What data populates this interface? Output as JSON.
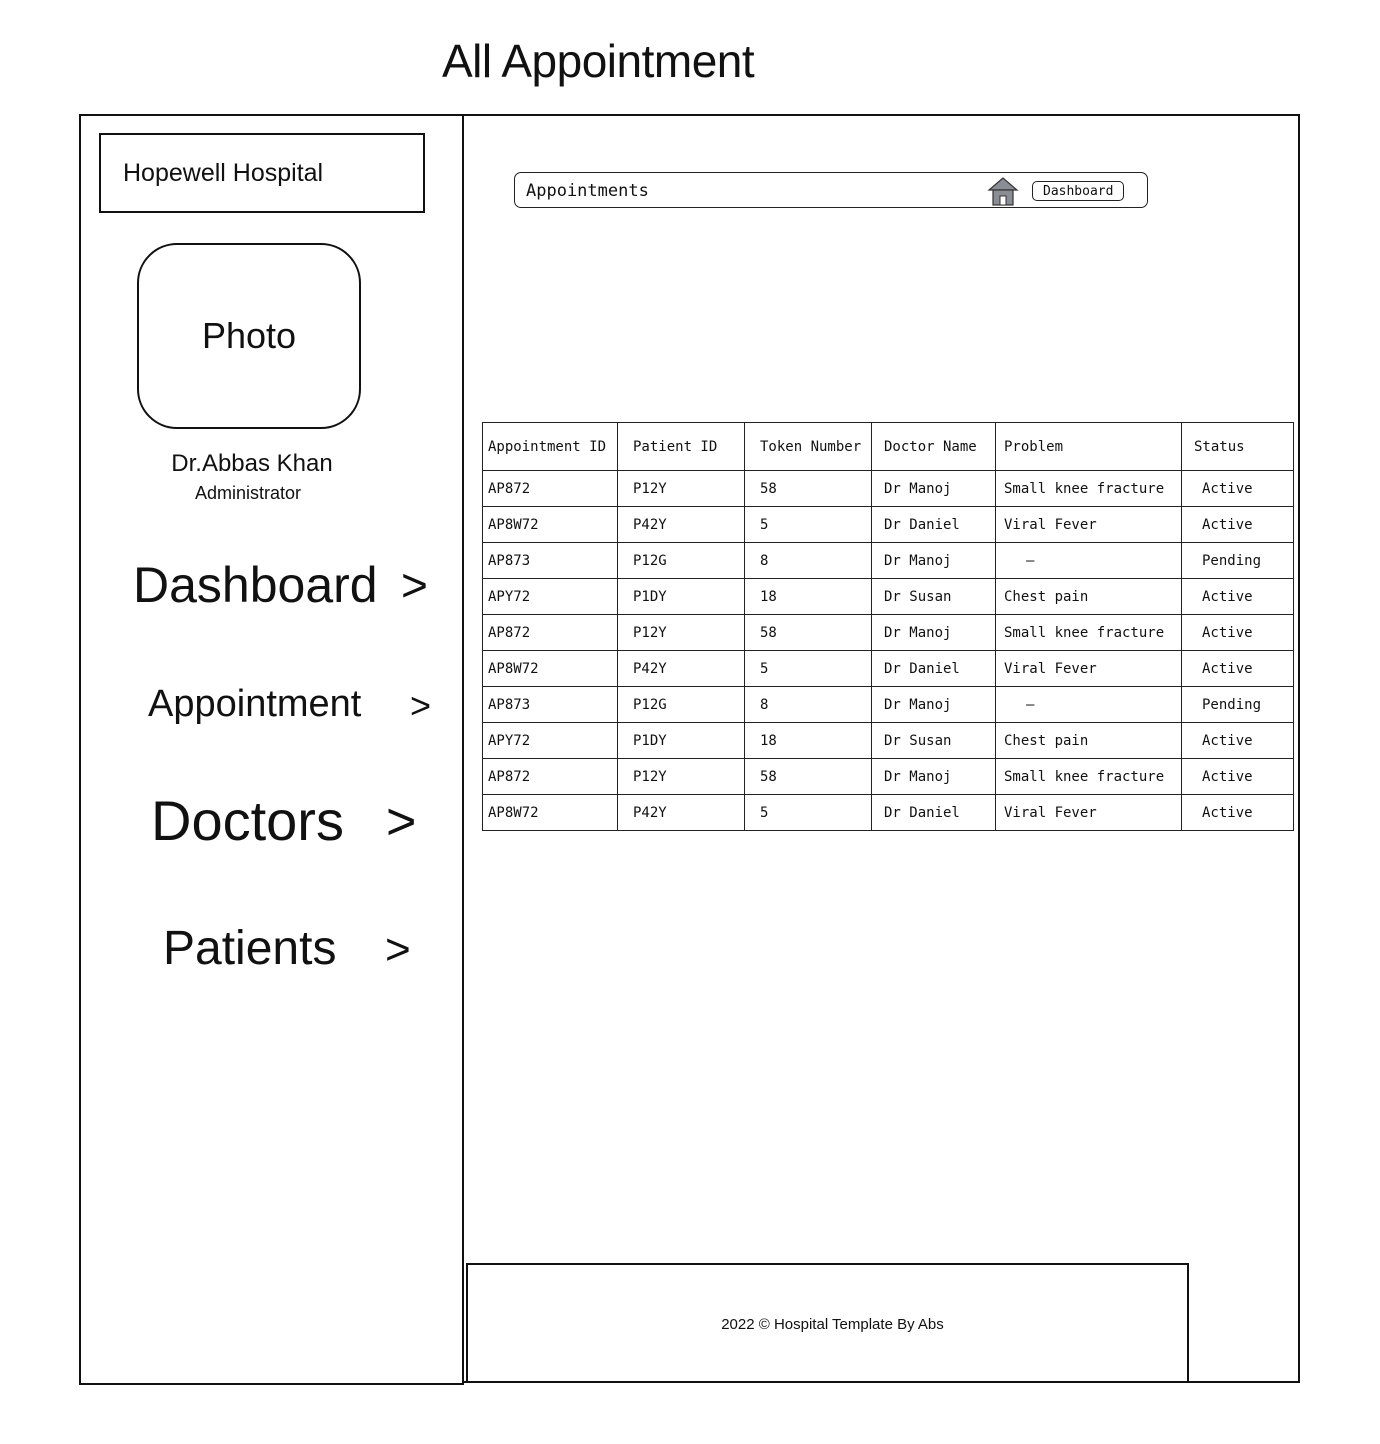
{
  "page": {
    "title": "All Appointment"
  },
  "sidebar": {
    "brand": "Hopewell Hospital",
    "photo_label": "Photo",
    "user_name": "Dr.Abbas Khan",
    "user_role": "Administrator",
    "nav": [
      {
        "label": "Dashboard",
        "chevron": ">"
      },
      {
        "label": "Appointment",
        "chevron": ">"
      },
      {
        "label": "Doctors",
        "chevron": ">"
      },
      {
        "label": "Patients",
        "chevron": ">"
      }
    ]
  },
  "main": {
    "breadcrumb": {
      "title": "Appointments",
      "icon": "home-icon",
      "button_label": "Dashboard"
    },
    "table": {
      "headers": [
        "Appointment ID",
        "Patient ID",
        "Token Number",
        "Doctor Name",
        "Problem",
        "Status"
      ],
      "rows": [
        [
          "AP872",
          "P12Y",
          "58",
          "Dr Manoj",
          "Small knee fracture",
          "Active"
        ],
        [
          "AP8W72",
          "P42Y",
          "5",
          "Dr Daniel",
          "Viral Fever",
          "Active"
        ],
        [
          "AP873",
          "P12G",
          "8",
          "Dr Manoj",
          "–",
          "Pending"
        ],
        [
          "APY72",
          "P1DY",
          "18",
          "Dr Susan",
          "Chest pain",
          "Active"
        ],
        [
          "AP872",
          "P12Y",
          "58",
          "Dr Manoj",
          "Small knee fracture",
          "Active"
        ],
        [
          "AP8W72",
          "P42Y",
          "5",
          "Dr Daniel",
          "Viral Fever",
          "Active"
        ],
        [
          "AP873",
          "P12G",
          "8",
          "Dr Manoj",
          "–",
          "Pending"
        ],
        [
          "APY72",
          "P1DY",
          "18",
          "Dr Susan",
          "Chest pain",
          "Active"
        ],
        [
          "AP872",
          "P12Y",
          "58",
          "Dr Manoj",
          "Small knee fracture",
          "Active"
        ],
        [
          "AP8W72",
          "P42Y",
          "5",
          "Dr Daniel",
          "Viral Fever",
          "Active"
        ]
      ]
    },
    "footer": "2022 ©  Hospital Template By Abs"
  }
}
